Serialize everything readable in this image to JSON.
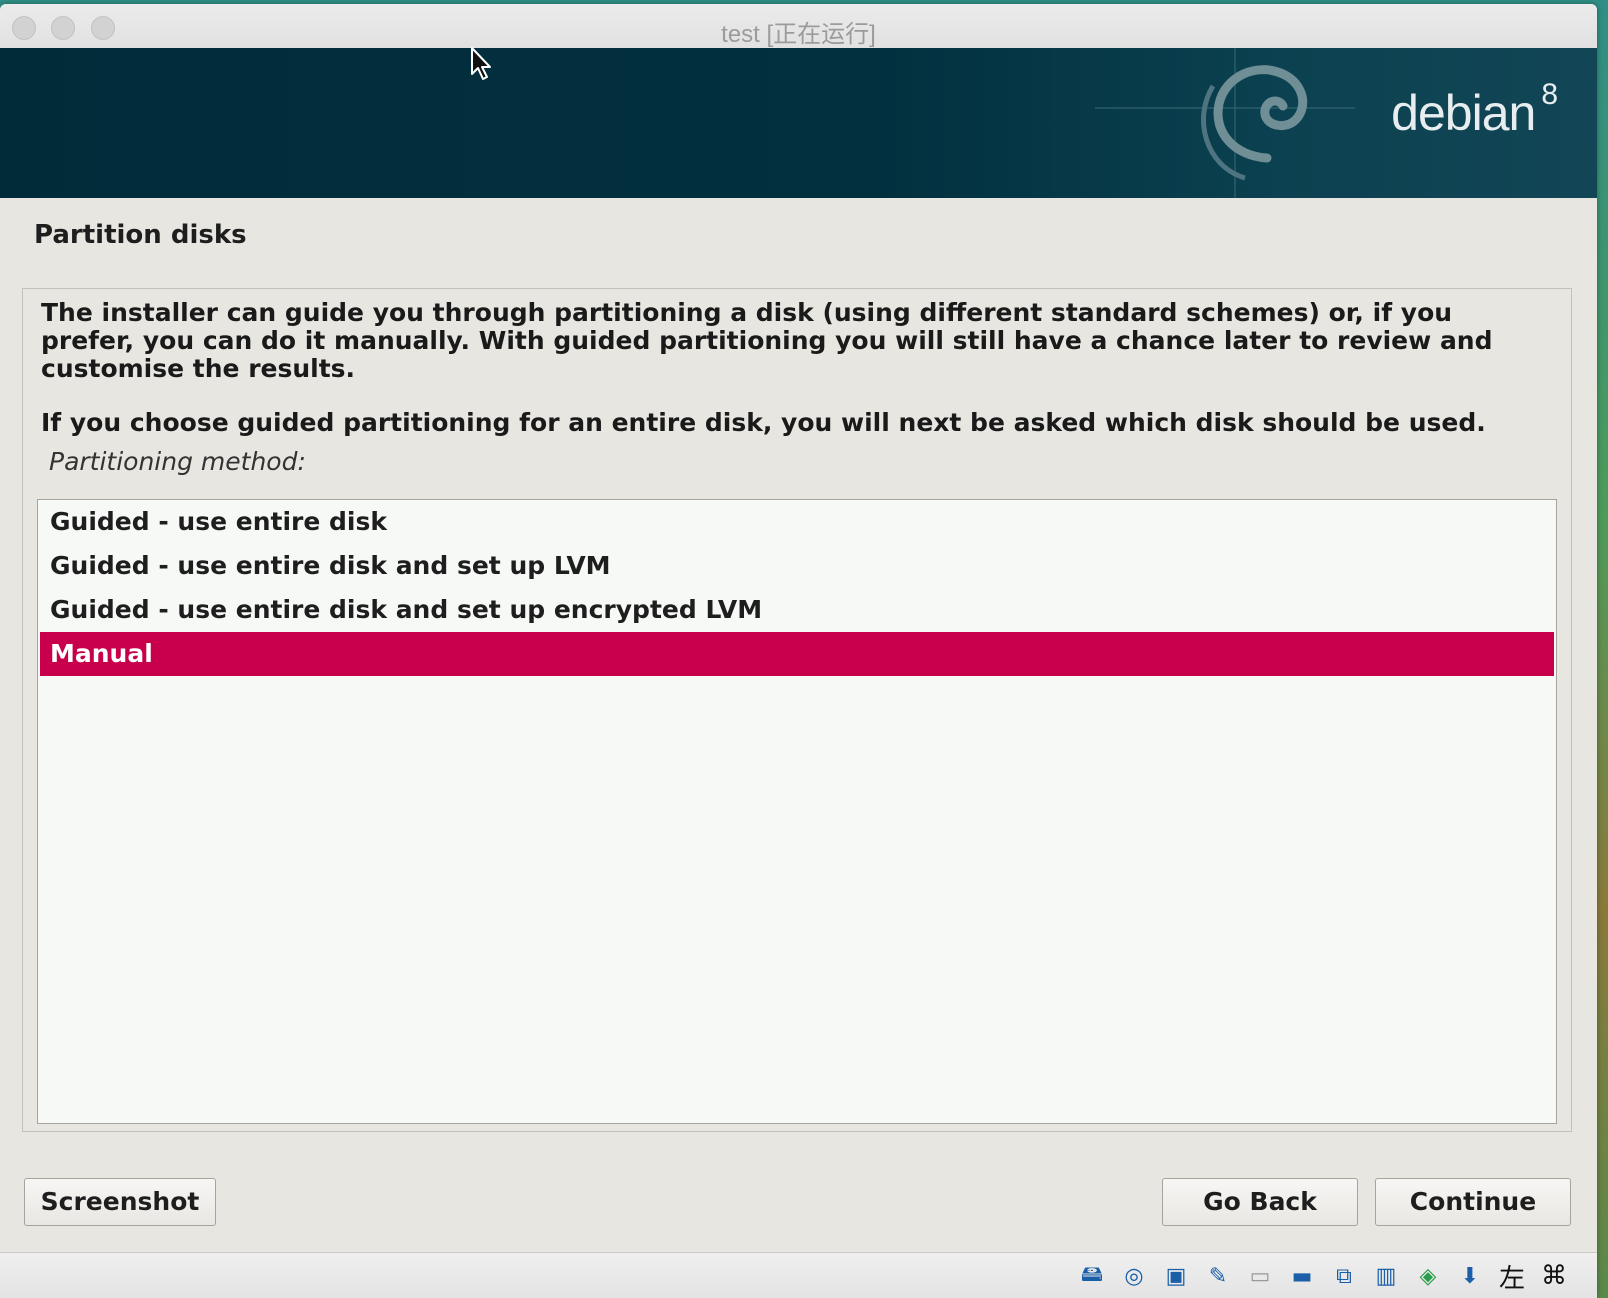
{
  "window": {
    "title": "test [正在运行]"
  },
  "banner": {
    "logo_text": "debian",
    "logo_version": "8"
  },
  "page": {
    "heading": "Partition disks",
    "description": "The installer can guide you through partitioning a disk (using different standard schemes) or, if you prefer, you can do it manually. With guided partitioning you will still have a chance later to review and customise the results.",
    "description2": "If you choose guided partitioning for an entire disk, you will next be asked which disk should be used.",
    "method_label": "Partitioning method:",
    "options": [
      {
        "label": "Guided - use entire disk",
        "selected": false
      },
      {
        "label": "Guided - use entire disk and set up LVM",
        "selected": false
      },
      {
        "label": "Guided - use entire disk and set up encrypted LVM",
        "selected": false
      },
      {
        "label": "Manual",
        "selected": true
      }
    ],
    "selection_color": "#c8004c"
  },
  "buttons": {
    "screenshot": "Screenshot",
    "go_back": "Go Back",
    "continue": "Continue"
  },
  "statusbar": {
    "icons": [
      "hard-disk-icon",
      "optical-drive-icon",
      "audio-icon",
      "usb-icon",
      "shared-folders-icon",
      "display-icon",
      "network-icon",
      "cpu-icon",
      "capture-icon",
      "download-icon"
    ],
    "host_key_label": "左",
    "command_symbol": "⌘"
  }
}
